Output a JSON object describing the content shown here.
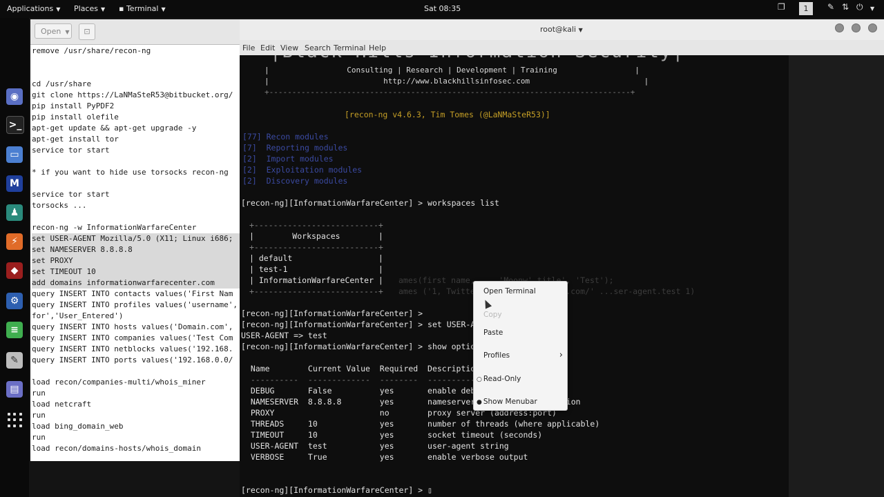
{
  "topbar": {
    "applications": "Applications",
    "places": "Places",
    "terminal": "Terminal",
    "clock": "Sat 08:35",
    "workspace_num": "1"
  },
  "dock": {
    "icons": [
      "browser-icon",
      "terminal-icon",
      "files-icon",
      "metasploit-icon",
      "armitage-icon",
      "burpsuite-icon",
      "red-app-icon",
      "settings-icon",
      "office-icon",
      "editor-icon",
      "notes-icon",
      "app-grid-icon"
    ]
  },
  "editor": {
    "open_label": "Open",
    "lines": [
      {
        "text": "remove /usr/share/recon-ng",
        "sel": false
      },
      {
        "text": "",
        "sel": false
      },
      {
        "text": "",
        "sel": false
      },
      {
        "text": "cd /usr/share",
        "sel": false
      },
      {
        "text": "git clone https://LaNMaSteR53@bitbucket.org/",
        "sel": false
      },
      {
        "text": "pip install PyPDF2",
        "sel": false
      },
      {
        "text": "pip install olefile",
        "sel": false
      },
      {
        "text": "apt-get update && apt-get upgrade -y",
        "sel": false
      },
      {
        "text": "apt-get install tor",
        "sel": false
      },
      {
        "text": "service tor start",
        "sel": false
      },
      {
        "text": "",
        "sel": false
      },
      {
        "text": "* if you want to hide use torsocks recon-ng",
        "sel": false
      },
      {
        "text": "",
        "sel": false
      },
      {
        "text": "service tor start",
        "sel": false
      },
      {
        "text": "torsocks ...",
        "sel": false
      },
      {
        "text": "",
        "sel": false
      },
      {
        "text": "recon-ng -w InformationWarfareCenter",
        "sel": false
      },
      {
        "text": "set USER-AGENT Mozilla/5.0 (X11; Linux i686;",
        "sel": true
      },
      {
        "text": "set NAMESERVER 8.8.8.8",
        "sel": true
      },
      {
        "text": "set PROXY",
        "sel": true
      },
      {
        "text": "set TIMEOUT 10",
        "sel": true
      },
      {
        "text": "add domains informationwarfarecenter.com",
        "sel": true
      },
      {
        "text": "query INSERT INTO contacts values('First Nam",
        "sel": false
      },
      {
        "text": "query INSERT INTO profiles values('username',",
        "sel": false
      },
      {
        "text": "for','User_Entered')",
        "sel": false
      },
      {
        "text": "query INSERT INTO hosts values('Domain.com',",
        "sel": false
      },
      {
        "text": "query INSERT INTO companies values('Test Com",
        "sel": false
      },
      {
        "text": "query INSERT INTO netblocks values('192.168.",
        "sel": false
      },
      {
        "text": "query INSERT INTO ports values('192.168.0.0/",
        "sel": false
      },
      {
        "text": "",
        "sel": false
      },
      {
        "text": "load recon/companies-multi/whois_miner",
        "sel": false
      },
      {
        "text": "run",
        "sel": false
      },
      {
        "text": "load netcraft",
        "sel": false
      },
      {
        "text": "run",
        "sel": false
      },
      {
        "text": "load bing_domain_web",
        "sel": false
      },
      {
        "text": "run",
        "sel": false
      },
      {
        "text": "load recon/domains-hosts/whois_domain",
        "sel": false
      }
    ]
  },
  "terminal": {
    "title": "root@kali",
    "menu": [
      "File",
      "Edit",
      "View",
      "Search",
      "Terminal",
      "Help"
    ],
    "banner_big": "|Black Hills Information Security|",
    "banner_line1": "|                 Consulting | Research | Development | Training                 |",
    "banner_line2": "|                         http://www.blackhillsinfosec.com                         |",
    "banner_border": "+-------------------------------------------------------------------------------+",
    "version": "[recon-ng v4.6.3, Tim Tomes (@LaNMaSteR53)]",
    "modules": [
      "[77] Recon modules",
      "[7]  Reporting modules",
      "[2]  Import modules",
      "[2]  Exploitation modules",
      "[2]  Discovery modules"
    ],
    "prompt_ws": "[recon-ng][InformationWarfareCenter] > workspaces list",
    "ws_border": "+--------------------------+",
    "ws_header": "|        Workspaces        |",
    "ws_rows": [
      "| default                  |",
      "| test-1                   |",
      "| InformationWarfareCenter |"
    ],
    "faint1": "ames(first name, ... 'Moonw' title', 'Test');",
    "faint2": "ames ('1, Twitter', 'http://twitter.com/' ...ser-agent.test 1)",
    "prompt_empty": "[recon-ng][InformationWarfareCenter] >",
    "prompt_set": "[recon-ng][InformationWarfareCenter] > set USER-AGENT test",
    "ua_echo": "USER-AGENT => test",
    "prompt_show": "[recon-ng][InformationWarfareCenter] > show options",
    "opt_header": "  Name        Current Value  Required  Description",
    "opt_sep": "  ----------  -------------  --------  -----------",
    "options": [
      "  DEBUG       False          yes       enable debugging output",
      "  NAMESERVER  8.8.8.8        yes       nameserver for DNS interrogation",
      "  PROXY                      no        proxy server (address:port)",
      "  THREADS     10             yes       number of threads (where applicable)",
      "  TIMEOUT     10             yes       socket timeout (seconds)",
      "  USER-AGENT  test           yes       user-agent string",
      "  VERBOSE     True           yes       enable verbose output"
    ],
    "prompt_final": "[recon-ng][InformationWarfareCenter] > ",
    "cursor": "▯"
  },
  "context_menu": {
    "open_terminal": "Open Terminal",
    "copy": "Copy",
    "paste": "Paste",
    "profiles": "Profiles",
    "read_only": "Read-Only",
    "show_menubar": "Show Menubar"
  }
}
